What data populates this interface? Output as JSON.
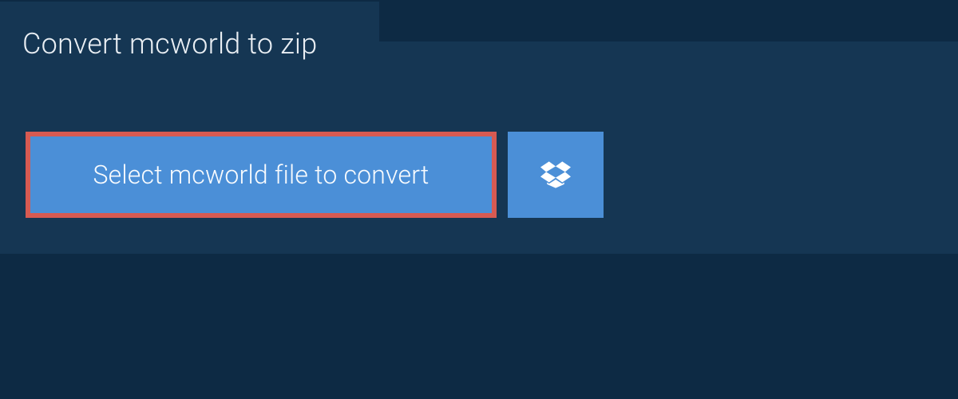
{
  "header": {
    "title": "Convert mcworld to zip"
  },
  "upload": {
    "select_label": "Select mcworld file to convert",
    "dropbox_icon": "dropbox"
  },
  "colors": {
    "page_bg": "#0d2a44",
    "panel_bg": "#153653",
    "button_bg": "#4b8fd7",
    "highlight_border": "#d75a52",
    "text_light": "#f8fbfe"
  }
}
